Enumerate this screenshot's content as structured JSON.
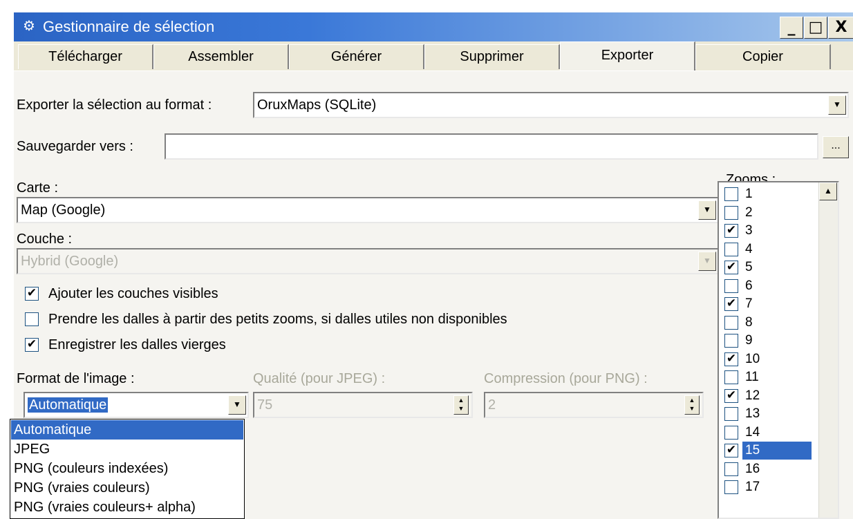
{
  "window": {
    "title": "Gestionnaire de sélection",
    "minimize": "_",
    "maximize": "□",
    "close": "X",
    "app_icon": "app-gear-icon"
  },
  "tabs": [
    {
      "label": "Télécharger"
    },
    {
      "label": "Assembler"
    },
    {
      "label": "Générer"
    },
    {
      "label": "Supprimer"
    },
    {
      "label": "Exporter",
      "active": true
    },
    {
      "label": "Copier"
    }
  ],
  "export": {
    "format_label": "Exporter la sélection au format :",
    "format_value": "OruxMaps (SQLite)",
    "save_label": "Sauvegarder vers :",
    "save_value": "",
    "browse": "..."
  },
  "map": {
    "carte_label": "Carte :",
    "carte_value": "Map (Google)",
    "couche_label": "Couche :",
    "couche_value": "Hybrid (Google)"
  },
  "options": [
    {
      "label": "Ajouter les couches visibles",
      "checked": true
    },
    {
      "label": "Prendre les dalles à partir des petits zooms, si dalles utiles non disponibles",
      "checked": false
    },
    {
      "label": "Enregistrer les dalles vierges",
      "checked": true
    }
  ],
  "image": {
    "format_label": "Format de l'image :",
    "format_value": "Automatique",
    "quality_label": "Qualité (pour JPEG) :",
    "quality_value": "75",
    "compression_label": "Compression (pour PNG) :",
    "compression_value": "2",
    "dropdown_options": [
      "Automatique",
      "JPEG",
      "PNG (couleurs indexées)",
      "PNG (vraies couleurs)",
      "PNG (vraies couleurs+ alpha)"
    ],
    "dropdown_selected": 0
  },
  "zooms": {
    "label": "Zooms :",
    "items": [
      {
        "n": "1",
        "checked": false
      },
      {
        "n": "2",
        "checked": false
      },
      {
        "n": "3",
        "checked": true
      },
      {
        "n": "4",
        "checked": false
      },
      {
        "n": "5",
        "checked": true
      },
      {
        "n": "6",
        "checked": false
      },
      {
        "n": "7",
        "checked": true
      },
      {
        "n": "8",
        "checked": false
      },
      {
        "n": "9",
        "checked": false
      },
      {
        "n": "10",
        "checked": true
      },
      {
        "n": "11",
        "checked": false
      },
      {
        "n": "12",
        "checked": true
      },
      {
        "n": "13",
        "checked": false
      },
      {
        "n": "14",
        "checked": false
      },
      {
        "n": "15",
        "checked": true,
        "selected": true
      },
      {
        "n": "16",
        "checked": false
      },
      {
        "n": "17",
        "checked": false
      }
    ]
  },
  "colors": {
    "titlebar": "#2b64c4",
    "selection": "#316ac5",
    "face": "#ece9d8"
  }
}
